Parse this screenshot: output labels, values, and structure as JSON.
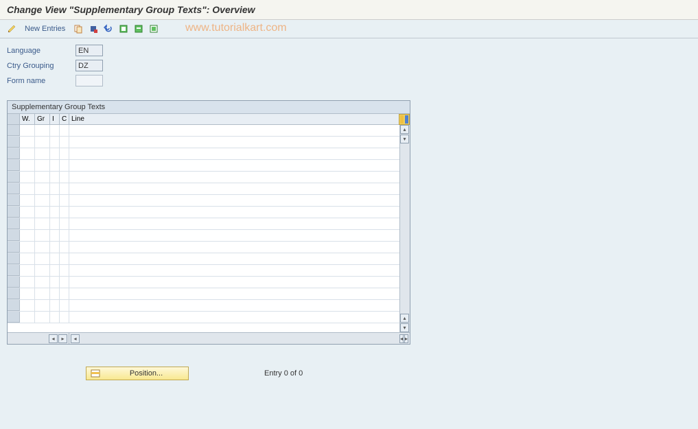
{
  "title": "Change View \"Supplementary Group Texts\": Overview",
  "toolbar": {
    "new_entries": "New Entries"
  },
  "watermark": "www.tutorialkart.com",
  "form": {
    "language_label": "Language",
    "language_value": "EN",
    "ctry_grouping_label": "Ctry Grouping",
    "ctry_grouping_value": "DZ",
    "form_name_label": "Form name",
    "form_name_value": ""
  },
  "table": {
    "title": "Supplementary Group Texts",
    "columns": {
      "w": "W.",
      "gr": "Gr",
      "i": "I",
      "c": "C",
      "line": "Line"
    },
    "rows": []
  },
  "footer": {
    "position_label": "Position...",
    "entry_info": "Entry 0 of 0"
  }
}
